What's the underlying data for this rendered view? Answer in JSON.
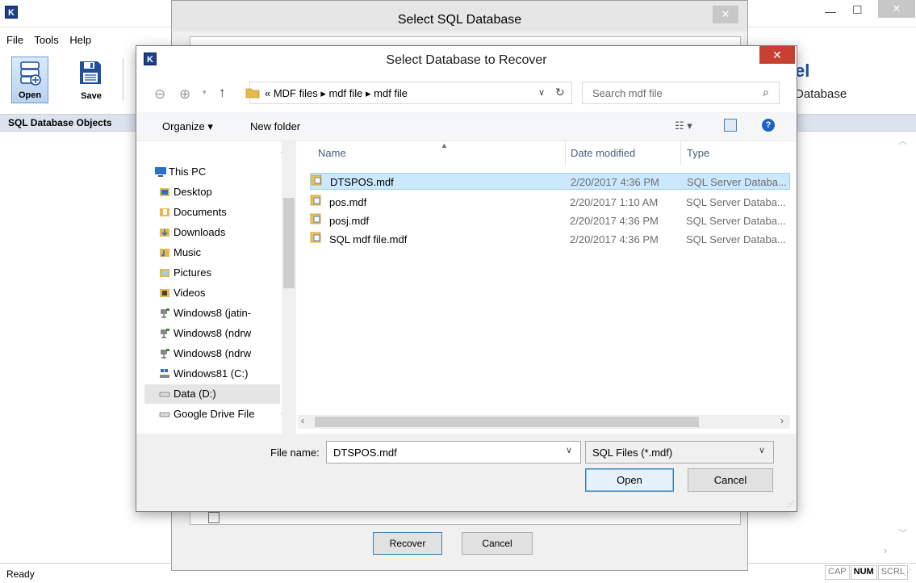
{
  "app": {
    "menu": [
      "File",
      "Tools",
      "Help"
    ],
    "toolbar": {
      "open_label": "Open",
      "save_label": "Save"
    },
    "left_panel_title": "SQL Database Objects",
    "brand_fragment": "el",
    "brand_subtitle": "Database",
    "status": "Ready",
    "indicators": [
      "CAP",
      "NUM",
      "SCRL"
    ]
  },
  "sql_dialog": {
    "title": "Select SQL Database",
    "recover_label": "Recover",
    "cancel_label": "Cancel"
  },
  "open_dialog": {
    "title": "Select Database to Recover",
    "breadcrumb": "« MDF files  ▸  mdf file  ▸  mdf file",
    "search_placeholder": "Search mdf file",
    "organize_label": "Organize ▾",
    "new_folder_label": "New folder",
    "tree": [
      "This PC",
      "Desktop",
      "Documents",
      "Downloads",
      "Music",
      "Pictures",
      "Videos",
      "Windows8 (jatin-",
      "Windows8 (ndrw",
      "Windows8 (ndrw",
      "Windows81 (C:)",
      "Data (D:)",
      "Google Drive File"
    ],
    "columns": {
      "name": "Name",
      "date": "Date modified",
      "type": "Type"
    },
    "files": [
      {
        "name": "DTSPOS.mdf",
        "date": "2/20/2017 4:36 PM",
        "type": "SQL Server Databa..."
      },
      {
        "name": "pos.mdf",
        "date": "2/20/2017 1:10 AM",
        "type": "SQL Server Databa..."
      },
      {
        "name": "posj.mdf",
        "date": "2/20/2017 4:36 PM",
        "type": "SQL Server Databa..."
      },
      {
        "name": "SQL mdf file.mdf",
        "date": "2/20/2017 4:36 PM",
        "type": "SQL Server Databa..."
      }
    ],
    "file_name_label": "File name:",
    "file_name_value": "DTSPOS.mdf",
    "file_type_value": "SQL Files (*.mdf)",
    "open_label": "Open",
    "cancel_label": "Cancel"
  },
  "colors": {
    "accent": "#0078d7",
    "selection": "#cce8ff",
    "close_red": "#c84031"
  }
}
